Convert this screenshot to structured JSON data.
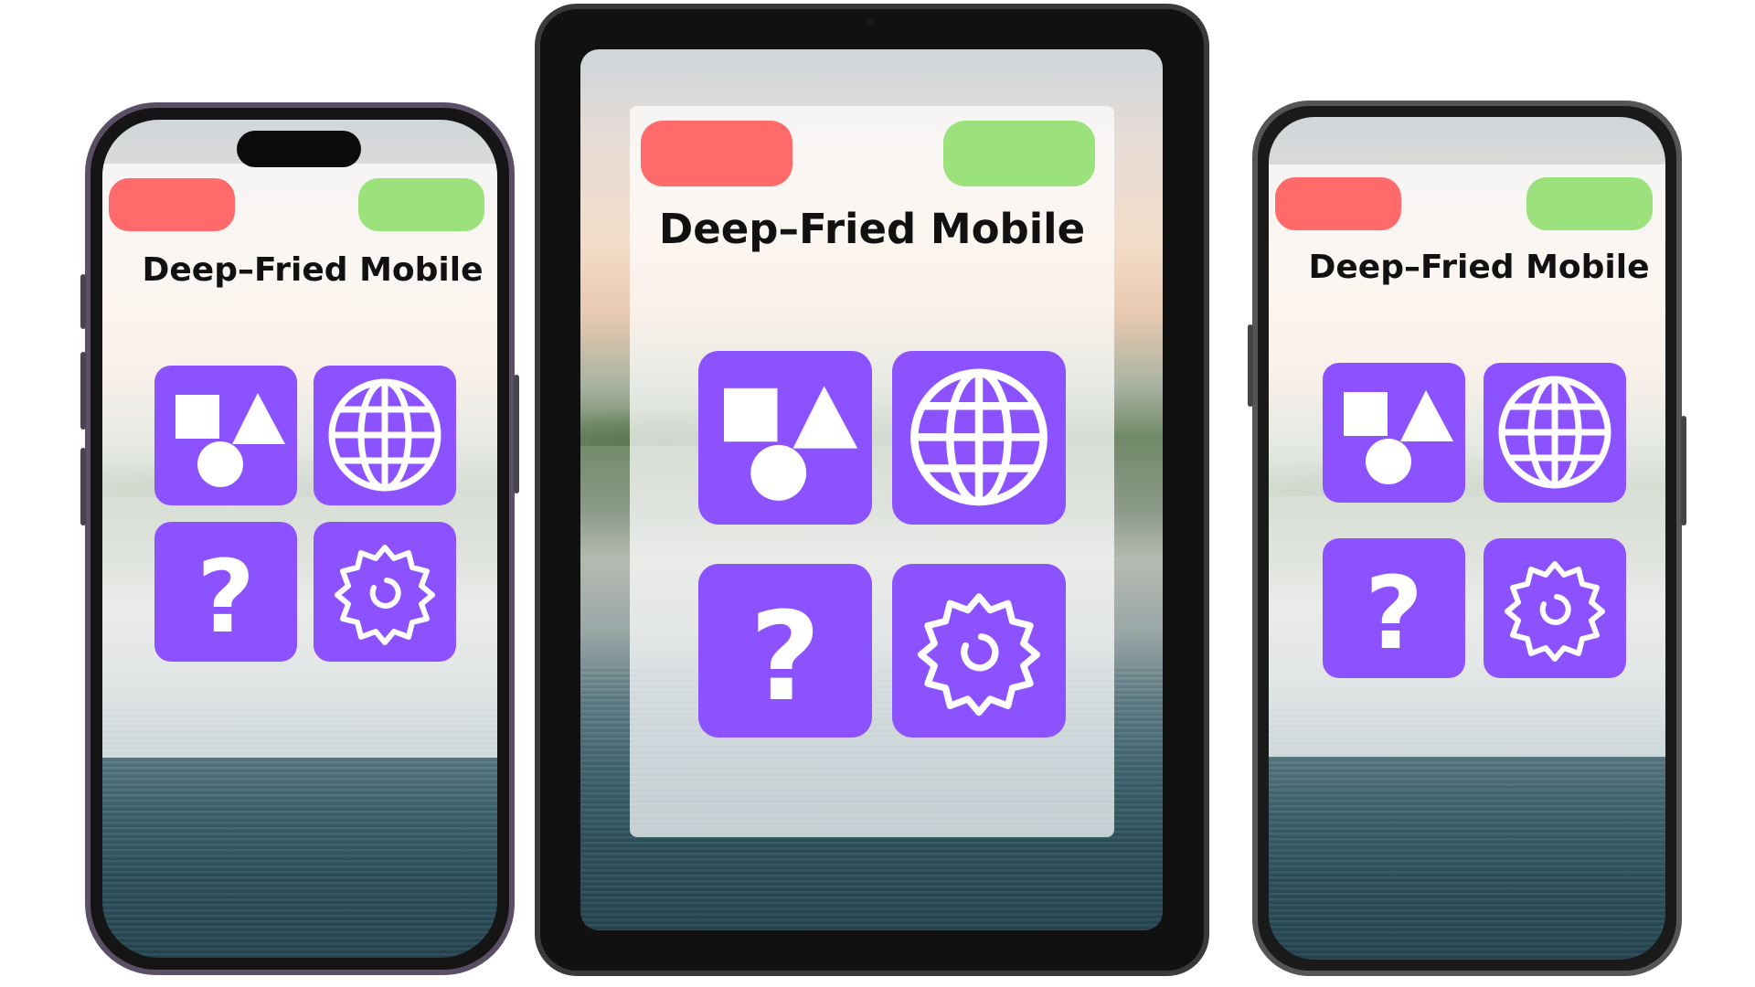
{
  "app": {
    "title": "Deep–Fried Mobile"
  },
  "colors": {
    "red_button": "#ff6b6b",
    "green_button": "#9be27d",
    "tile": "#8c52ff",
    "icon": "#ffffff"
  },
  "devices": [
    {
      "name": "phone-left",
      "title": "Deep–Fried Mobile",
      "tiles": [
        "shapes-icon",
        "globe-icon",
        "question-icon",
        "gear-icon"
      ]
    },
    {
      "name": "tablet-center",
      "title": "Deep–Fried Mobile",
      "tiles": [
        "shapes-icon",
        "globe-icon",
        "question-icon",
        "gear-icon"
      ]
    },
    {
      "name": "phone-right",
      "title": "Deep–Fried Mobile",
      "tiles": [
        "shapes-icon",
        "globe-icon",
        "question-icon",
        "gear-icon"
      ]
    }
  ]
}
